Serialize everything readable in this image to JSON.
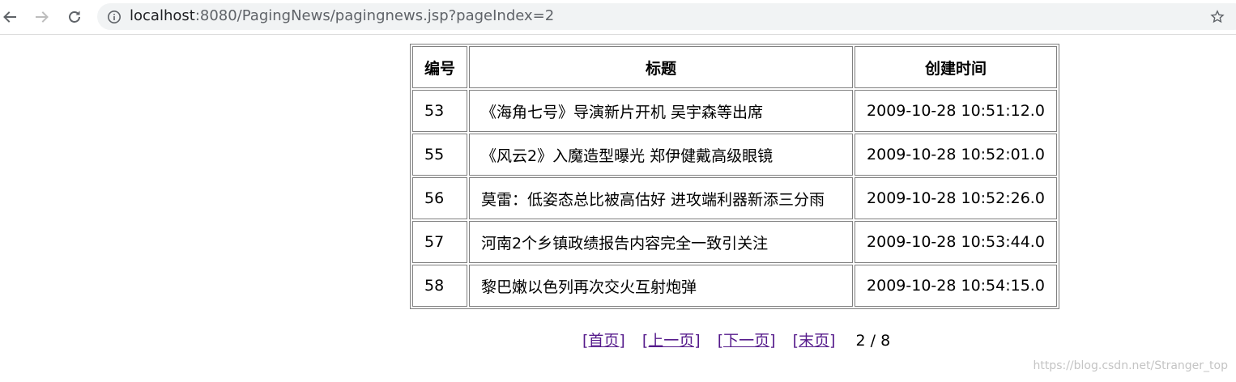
{
  "browser": {
    "url_host": "localhost",
    "url_rest": ":8080/PagingNews/pagingnews.jsp?pageIndex=2"
  },
  "table": {
    "headers": [
      "编号",
      "标题",
      "创建时间"
    ],
    "rows": [
      {
        "id": "53",
        "title": "《海角七号》导演新片开机 吴宇森等出席",
        "time": "2009-10-28 10:51:12.0"
      },
      {
        "id": "55",
        "title": "《风云2》入魔造型曝光 郑伊健戴高级眼镜",
        "time": "2009-10-28 10:52:01.0"
      },
      {
        "id": "56",
        "title": "莫雷：低姿态总比被高估好 进攻端利器新添三分雨",
        "time": "2009-10-28 10:52:26.0"
      },
      {
        "id": "57",
        "title": "河南2个乡镇政绩报告内容完全一致引关注",
        "time": "2009-10-28 10:53:44.0"
      },
      {
        "id": "58",
        "title": "黎巴嫩以色列再次交火互射炮弹",
        "time": "2009-10-28 10:54:15.0"
      }
    ]
  },
  "pager": {
    "first": "[首页]",
    "prev": "[上一页]",
    "next": "[下一页]",
    "last": "[末页]",
    "status": "2 / 8"
  },
  "watermark": "https://blog.csdn.net/Stranger_top",
  "colors": {
    "link": "#551a8b",
    "omnibox_bg": "#f1f3f4",
    "table_border": "#808080"
  }
}
